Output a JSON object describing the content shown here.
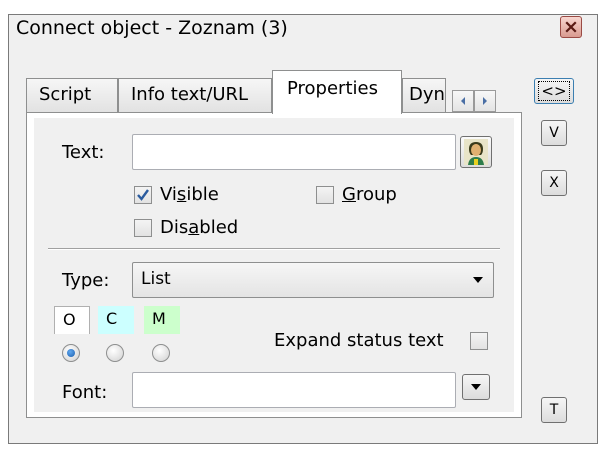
{
  "window": {
    "title": "Connect object - Zoznam (3)"
  },
  "tabs": [
    {
      "label": "Script",
      "active": false
    },
    {
      "label": "Info text/URL",
      "active": false
    },
    {
      "label": "Properties",
      "active": true
    },
    {
      "label": "Dyn.s",
      "active": false
    }
  ],
  "side_buttons": {
    "swap": "<>",
    "v": "V",
    "x": "X",
    "t": "T"
  },
  "properties": {
    "text_label": "Text:",
    "text_value": "",
    "visible": {
      "label_pre": "Vi",
      "label_u": "s",
      "label_post": "ible",
      "checked": true
    },
    "group": {
      "label_pre": "",
      "label_u": "G",
      "label_post": "roup",
      "checked": false
    },
    "disabled": {
      "label_pre": "Dis",
      "label_u": "a",
      "label_post": "bled",
      "checked": false
    },
    "type_label": "Type:",
    "type_value": "List",
    "omc_tabs": [
      {
        "label": "O",
        "color": "#ffffff"
      },
      {
        "label": "C",
        "color": "#ccffff"
      },
      {
        "label": "M",
        "color": "#ccffcc"
      }
    ],
    "omc_selected_index": 0,
    "expand_status_label": "Expand status text",
    "expand_status_checked": false,
    "font_label": "Font:",
    "font_value": ""
  },
  "icons": {
    "close": "close-icon",
    "person": "person-icon",
    "check": "checkmark-icon",
    "dropdown": "chevron-down-icon"
  }
}
